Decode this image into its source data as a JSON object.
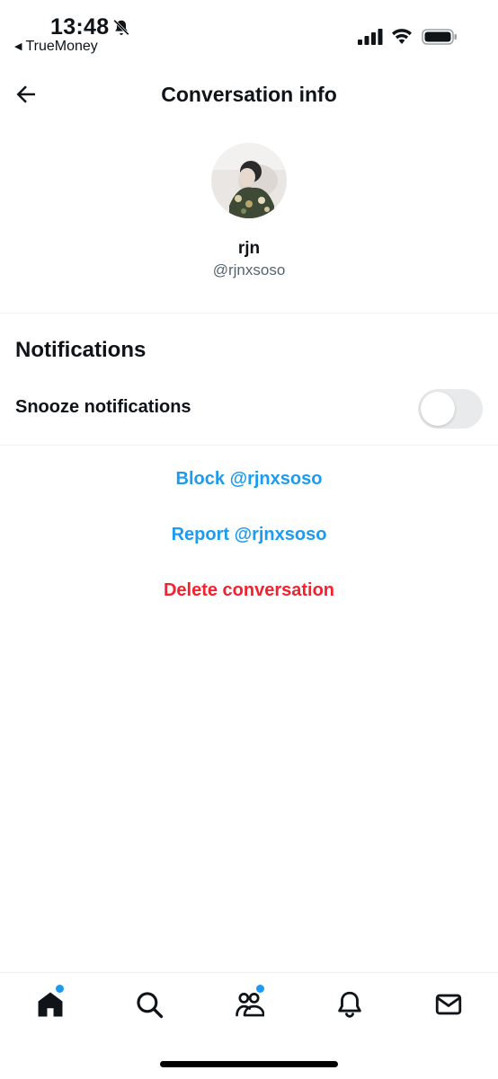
{
  "status_bar": {
    "time": "13:48",
    "back_app": "TrueMoney"
  },
  "header": {
    "title": "Conversation info"
  },
  "profile": {
    "name": "rjn",
    "handle": "@rjnxsoso"
  },
  "notifications": {
    "section_title": "Notifications",
    "snooze_label": "Snooze notifications",
    "snooze_enabled": false
  },
  "actions": {
    "block": "Block @rjnxsoso",
    "report": "Report @rjnxsoso",
    "delete": "Delete conversation"
  },
  "bottom_nav": {
    "items": [
      {
        "icon": "home-icon",
        "active": true,
        "badge": true
      },
      {
        "icon": "search-icon",
        "active": false,
        "badge": false
      },
      {
        "icon": "communities-icon",
        "active": false,
        "badge": true
      },
      {
        "icon": "bell-icon",
        "active": false,
        "badge": false
      },
      {
        "icon": "mail-icon",
        "active": false,
        "badge": false
      }
    ]
  },
  "colors": {
    "accent": "#1d9bf0",
    "danger": "#f4212e",
    "text": "#0f1419",
    "secondary": "#536471"
  }
}
